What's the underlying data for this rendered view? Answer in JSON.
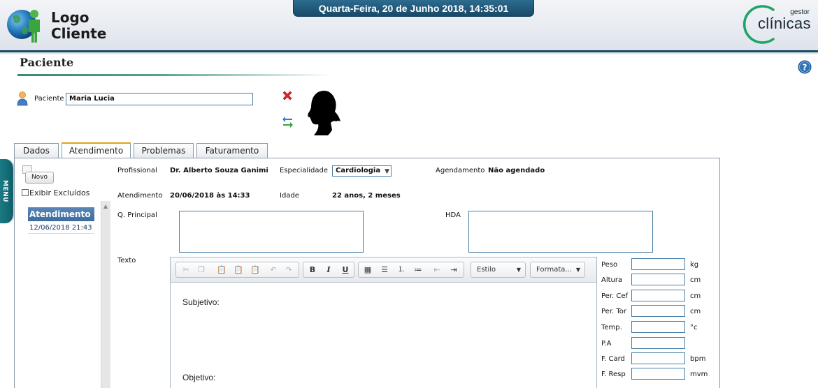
{
  "header": {
    "logo_line1": "Logo",
    "logo_line2": "Cliente",
    "datetime": "Quarta-Feira, 20 de Junho 2018, 14:35:01",
    "brand_small": "gestor",
    "brand_big": "clínicas"
  },
  "menu": {
    "label": "MENU"
  },
  "page": {
    "title": "Paciente"
  },
  "patient": {
    "label": "Paciente",
    "value": "Maria Lucia"
  },
  "tabs": [
    {
      "label": "Dados"
    },
    {
      "label": "Atendimento"
    },
    {
      "label": "Problemas"
    },
    {
      "label": "Faturamento"
    }
  ],
  "active_tab": "Atendimento",
  "sidebar": {
    "new_button": "Novo",
    "show_excluded": "Exibir Excluídos",
    "list_header": "Atendimento",
    "items": [
      {
        "label": "12/06/2018 21:43"
      }
    ]
  },
  "form": {
    "profissional_label": "Profissional",
    "profissional_value": "Dr. Alberto Souza Ganimi",
    "especialidade_label": "Especialidade",
    "especialidade_value": "Cardiologia",
    "agendamento_label": "Agendamento",
    "agendamento_value": "Não agendado",
    "atendimento_label": "Atendimento",
    "atendimento_value": "20/06/2018 às 14:33",
    "idade_label": "Idade",
    "idade_value": "22 anos, 2 meses",
    "q_principal_label": "Q. Principal",
    "hda_label": "HDA",
    "texto_label": "Texto"
  },
  "editor": {
    "style_dropdown": "Estilo",
    "format_dropdown": "Formata...",
    "body_lines": [
      "Subjetivo:",
      "Objetivo:"
    ]
  },
  "vitals": [
    {
      "label": "Peso",
      "unit": "kg"
    },
    {
      "label": "Altura",
      "unit": "cm"
    },
    {
      "label": "Per. Cef",
      "unit": "cm"
    },
    {
      "label": "Per. Tor",
      "unit": "cm"
    },
    {
      "label": "Temp.",
      "unit": "°c"
    },
    {
      "label": "P.A",
      "unit": ""
    },
    {
      "label": "F. Card",
      "unit": "bpm"
    },
    {
      "label": "F. Resp",
      "unit": "mvm"
    }
  ],
  "colors": {
    "header_rule": "#1e4a63",
    "date_bar": "#1f5a7c",
    "input_border": "#4a7fa8",
    "list_header": "#4a78aa",
    "active_tab_accent": "#e3a21a",
    "brand_ring": "#1ea36a"
  },
  "icons": {
    "logo": "globe-person-icon",
    "help": "help-icon",
    "patient": "user-icon",
    "remove": "close-icon",
    "swap": "swap-arrows-icon",
    "photo": "patient-silhouette"
  }
}
